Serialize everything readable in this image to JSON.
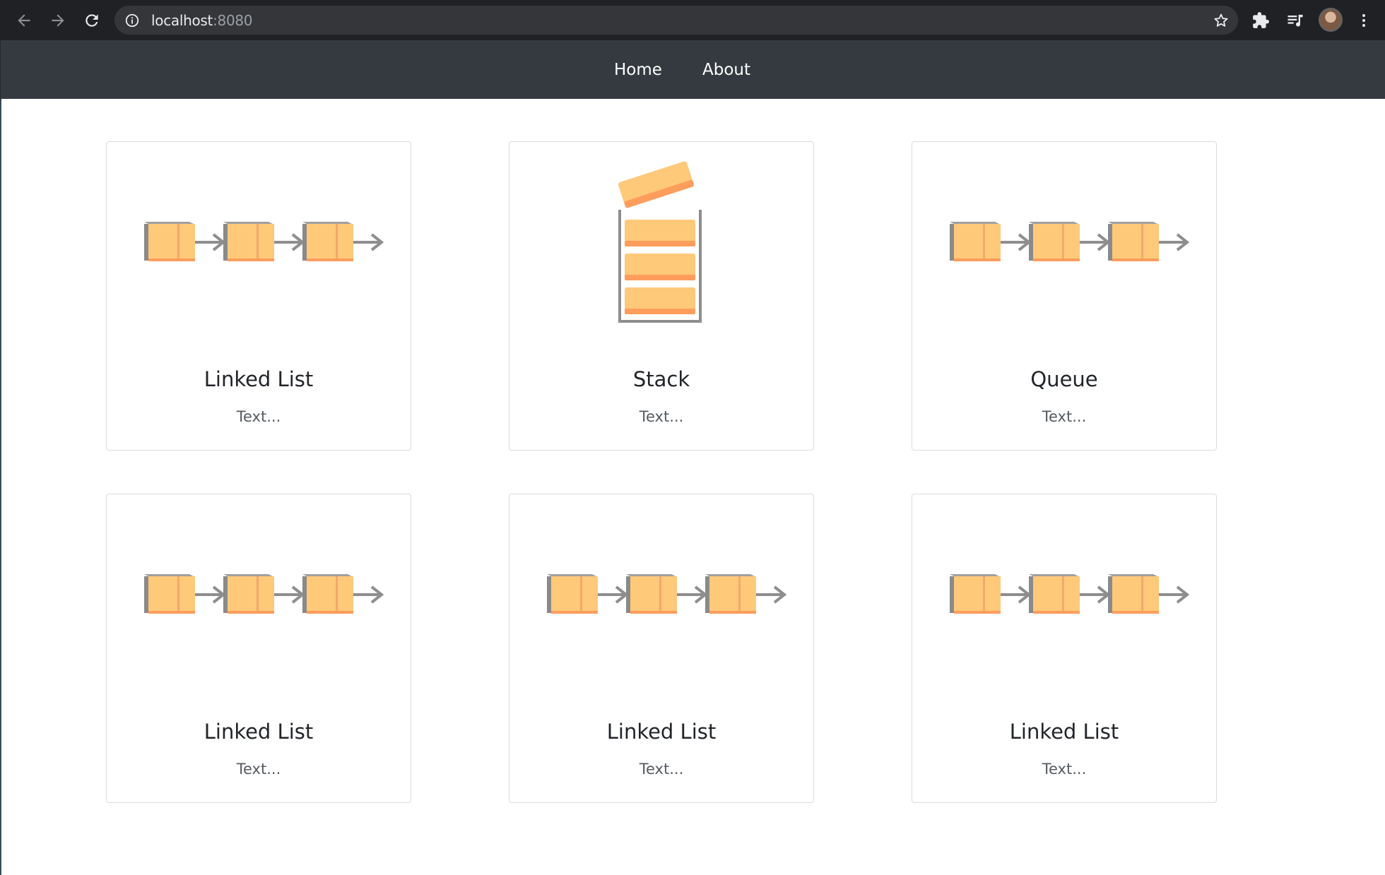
{
  "browser": {
    "url_host": "localhost",
    "url_port": ":8080",
    "icons": [
      "back-arrow-icon",
      "forward-arrow-icon",
      "reload-icon",
      "info-icon",
      "star-icon",
      "extensions-puzzle-icon",
      "media-queue-icon",
      "profile-avatar",
      "menu-dots-icon"
    ],
    "colors": {
      "frame": "#202124",
      "omnibox": "#35363a",
      "icon": "#c4c7c5"
    }
  },
  "navbar": {
    "links": [
      {
        "label": "Home"
      },
      {
        "label": "About"
      }
    ],
    "colors": {
      "background": "#343a40",
      "text": "#ffffff"
    }
  },
  "cards": [
    {
      "title": "Linked List",
      "text": "Text...",
      "image": "linked-list-illustration"
    },
    {
      "title": "Stack",
      "text": "Text...",
      "image": "stack-illustration"
    },
    {
      "title": "Queue",
      "text": "Text...",
      "image": "linked-list-illustration"
    },
    {
      "title": "Linked List",
      "text": "Text...",
      "image": "linked-list-illustration"
    },
    {
      "title": "Linked List",
      "text": "Text...",
      "image": "linked-list-illustration"
    },
    {
      "title": "Linked List",
      "text": "Text...",
      "image": "linked-list-illustration"
    }
  ],
  "illustration_colors": {
    "box_face": "#ffc97a",
    "box_side": "#f4a86a",
    "box_edge": "#ff9d5c",
    "box_back": "#8a8a8a",
    "arrow": "#8e8e8e"
  }
}
